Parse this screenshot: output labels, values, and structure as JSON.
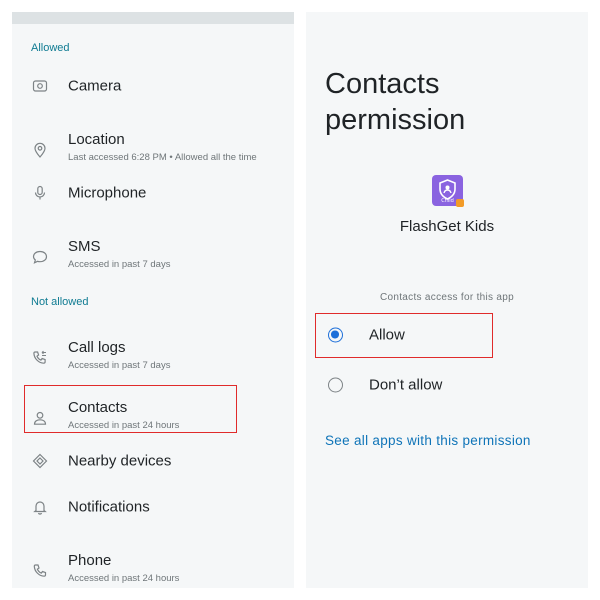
{
  "permissions_list": {
    "allowed_header": "Allowed",
    "not_allowed_header": "Not allowed",
    "allowed": [
      {
        "title": "Camera",
        "subtitle": "",
        "icon": "camera-icon"
      },
      {
        "title": "Location",
        "subtitle": "Last accessed 6:28 PM • Allowed all the time",
        "icon": "location-icon"
      },
      {
        "title": "Microphone",
        "subtitle": "",
        "icon": "microphone-icon"
      },
      {
        "title": "SMS",
        "subtitle": "Accessed in past 7 days",
        "icon": "sms-icon"
      }
    ],
    "not_allowed": [
      {
        "title": "Call logs",
        "subtitle": "Accessed in past 7 days",
        "icon": "call-log-icon"
      },
      {
        "title": "Contacts",
        "subtitle": "Accessed in past 24 hours",
        "icon": "contacts-icon",
        "highlighted": true
      },
      {
        "title": "Nearby devices",
        "subtitle": "",
        "icon": "nearby-devices-icon"
      },
      {
        "title": "Notifications",
        "subtitle": "",
        "icon": "notifications-icon"
      },
      {
        "title": "Phone",
        "subtitle": "Accessed in past 24 hours",
        "icon": "phone-icon"
      }
    ]
  },
  "permission_detail": {
    "title": "Contacts permission",
    "app_name": "FlashGet Kids",
    "app_icon_text": "Child",
    "access_label": "Contacts access for this app",
    "options": [
      {
        "label": "Allow",
        "selected": true,
        "highlighted": true
      },
      {
        "label": "Don’t allow",
        "selected": false
      }
    ],
    "see_all_link": "See all apps with this permission"
  },
  "colors": {
    "panel_bg": "#f5f7f8",
    "section_header": "#0f7b92",
    "highlight_border": "#e02b2b",
    "radio_selected": "#1d6fd9",
    "link": "#0f74b8",
    "app_icon_bg": "#8a63e0",
    "app_icon_badge": "#f29b27"
  }
}
